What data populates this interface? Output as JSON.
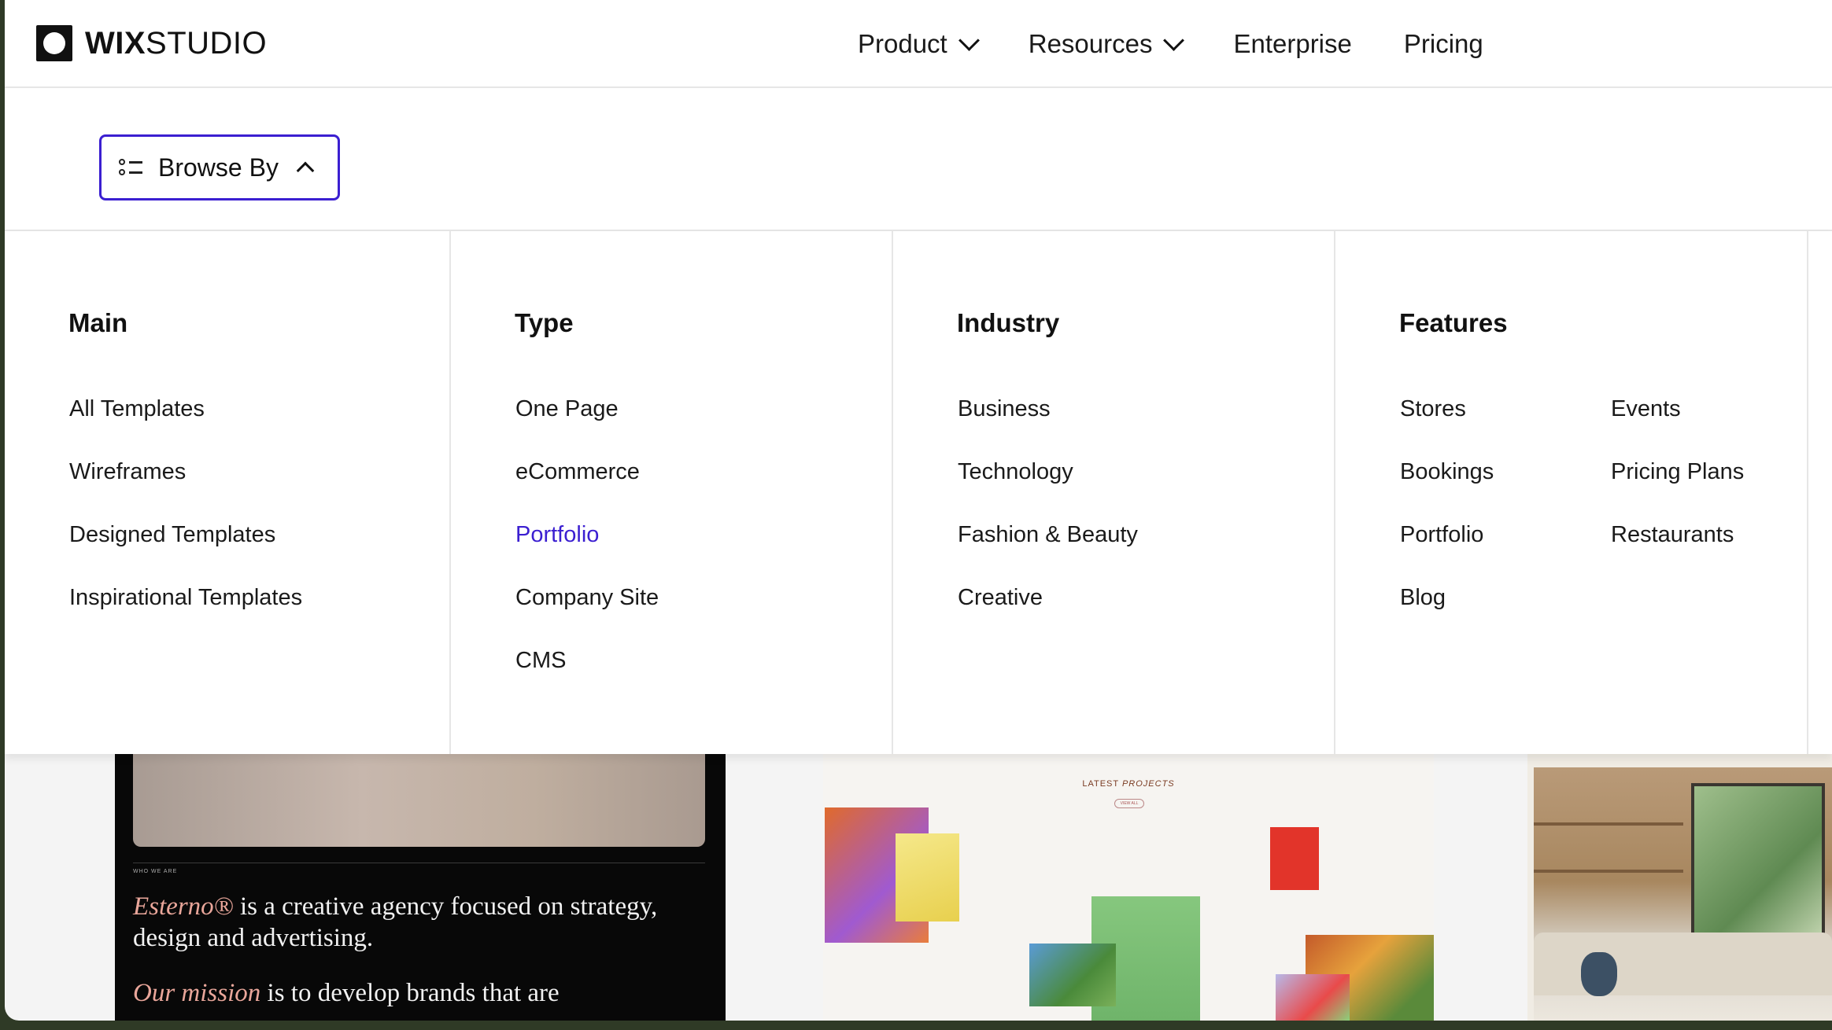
{
  "brand": {
    "logo_bold": "WIX",
    "logo_light": "STUDIO"
  },
  "nav": {
    "items": [
      {
        "label": "Product",
        "has_dropdown": true
      },
      {
        "label": "Resources",
        "has_dropdown": true
      },
      {
        "label": "Enterprise",
        "has_dropdown": false
      },
      {
        "label": "Pricing",
        "has_dropdown": false
      }
    ]
  },
  "browse": {
    "label": "Browse By",
    "icon": "list-icon",
    "state": "expanded"
  },
  "menu": {
    "main": {
      "title": "Main",
      "items": [
        "All Templates",
        "Wireframes",
        "Designed Templates",
        "Inspirational Templates"
      ]
    },
    "type": {
      "title": "Type",
      "items": [
        "One Page",
        "eCommerce",
        "Portfolio",
        "Company Site",
        "CMS"
      ],
      "active": "Portfolio"
    },
    "industry": {
      "title": "Industry",
      "items": [
        "Business",
        "Technology",
        "Fashion & Beauty",
        "Creative"
      ]
    },
    "features": {
      "title": "Features",
      "items_col1": [
        "Stores",
        "Bookings",
        "Portfolio",
        "Blog"
      ],
      "items_col2": [
        "Events",
        "Pricing Plans",
        "Restaurants"
      ]
    }
  },
  "cards": {
    "card1": {
      "tiny_label": "WHO WE ARE",
      "line1_em": "Esterno®",
      "line1_rest": " is a creative agency focused on strategy, design and advertising.",
      "line2_em": "Our mission",
      "line2_rest": " is to develop brands that are"
    },
    "card2": {
      "heading_a": "LATEST ",
      "heading_b": "PROJECTS",
      "view_all": "VIEW ALL"
    }
  },
  "colors": {
    "accent": "#3b1fd1",
    "text": "#111111",
    "border": "#e6e6e6"
  }
}
